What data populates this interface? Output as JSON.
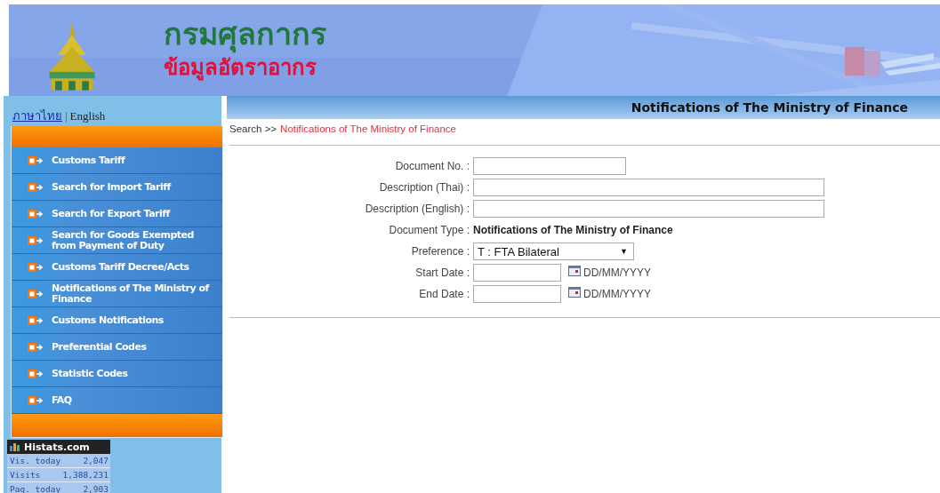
{
  "header": {
    "title": "กรมศุลกากร",
    "subtitle": "ข้อมูลอัตราอากร"
  },
  "sidebar": {
    "languages": [
      {
        "label": "ภาษาไทย",
        "selected": false
      },
      {
        "label": "English",
        "selected": true
      }
    ],
    "separator": "|",
    "menu": [
      {
        "label": "Customs Tariff"
      },
      {
        "label": "Search for Import Tariff"
      },
      {
        "label": "Search for Export Tariff"
      },
      {
        "label": "Search for Goods Exempted from Payment of Duty"
      },
      {
        "label": "Customs Tariff Decree/Acts"
      },
      {
        "label": "Notifications of The Ministry of Finance"
      },
      {
        "label": "Customs Notifications"
      },
      {
        "label": "Preferential Codes"
      },
      {
        "label": "Statistic Codes"
      },
      {
        "label": "FAQ"
      }
    ],
    "counter": {
      "title": "Histats.com",
      "rows": [
        {
          "label": "Vis. today",
          "value": "2,047"
        },
        {
          "label": "Visits",
          "value": "1,388,231"
        },
        {
          "label": "Pag. today",
          "value": "2,903"
        }
      ]
    }
  },
  "main": {
    "title": "Notifications of The Ministry of Finance",
    "breadcrumb": {
      "root": "Search >>",
      "current": "Notifications of The Ministry of Finance"
    },
    "form": [
      {
        "kind": "short-text",
        "label": "Document No. :"
      },
      {
        "kind": "text",
        "label": "Description (Thai) :"
      },
      {
        "kind": "text",
        "label": "Description (English) :"
      },
      {
        "kind": "static",
        "label": "Document Type :",
        "value": "Notifications of The Ministry of Finance"
      },
      {
        "kind": "select",
        "label": "Preference :",
        "value": "T : FTA Bilateral",
        "arrow": "▼"
      },
      {
        "kind": "date",
        "label": "Start Date :",
        "format": "DD/MM/YYYY"
      },
      {
        "kind": "date",
        "label": "End Date :",
        "format": "DD/MM/YYYY"
      }
    ]
  }
}
